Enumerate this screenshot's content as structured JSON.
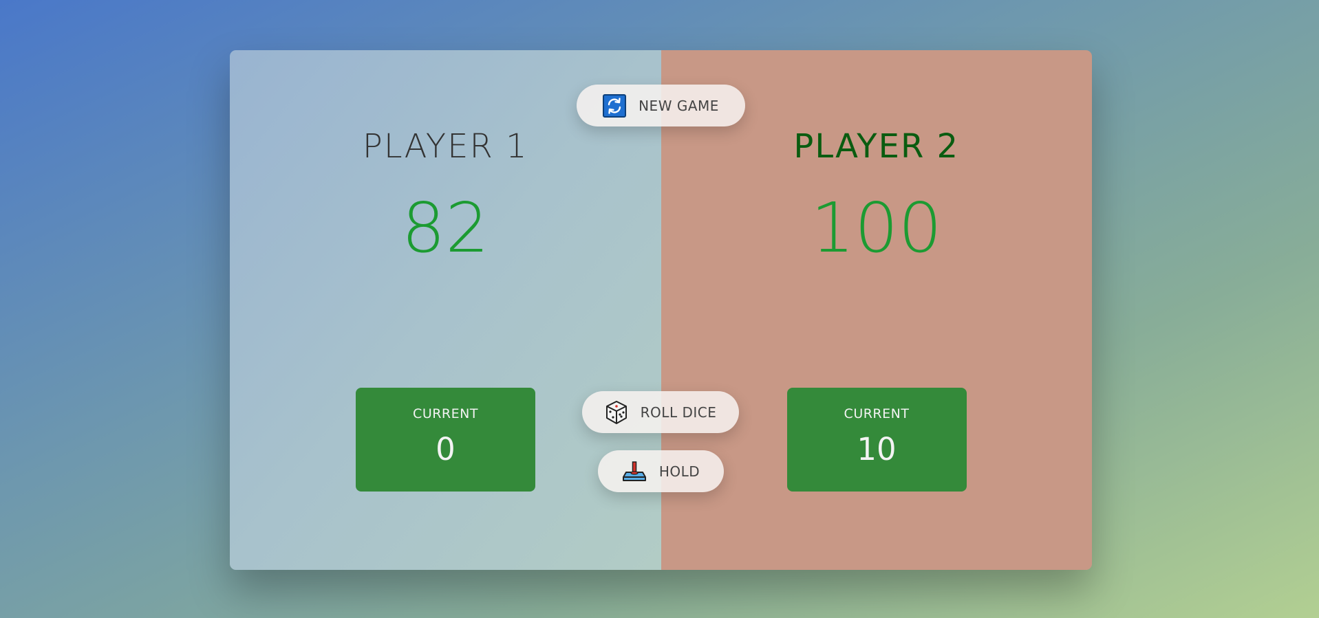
{
  "players": [
    {
      "name": "PLAYER 1",
      "score": "82",
      "current_label": "CURRENT",
      "current_score": "0"
    },
    {
      "name": "PLAYER 2",
      "score": "100",
      "current_label": "CURRENT",
      "current_score": "10",
      "winner": true
    }
  ],
  "buttons": {
    "new_game": {
      "label": "NEW GAME",
      "icon": "refresh-icon"
    },
    "roll_dice": {
      "label": "ROLL DICE",
      "icon": "dice-icon"
    },
    "hold": {
      "label": "HOLD",
      "icon": "hold-lever-icon"
    }
  },
  "colors": {
    "score": "#1c9b32",
    "current_box": "#348a3a",
    "winner_name": "#0a5c10",
    "player1_panel": "#a8c2cc",
    "player2_panel": "#c89886"
  }
}
